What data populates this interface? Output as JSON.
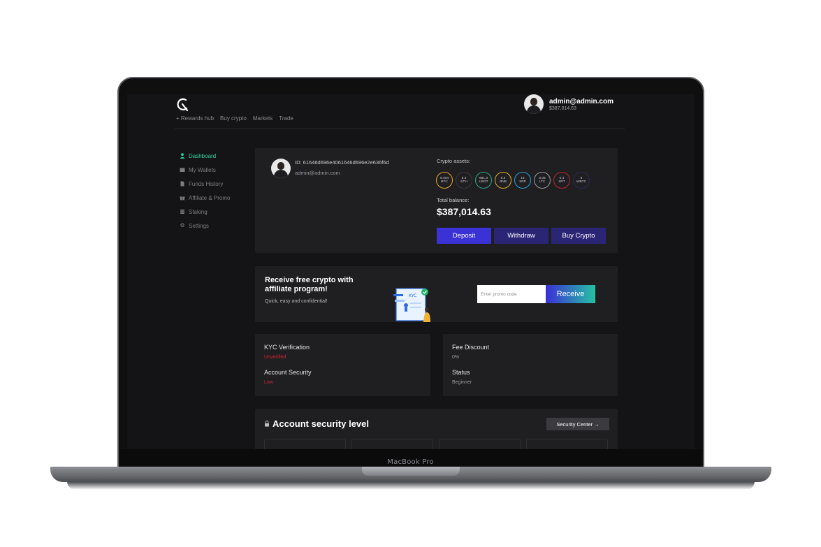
{
  "device": {
    "brand_label": "MacBook Pro"
  },
  "app": {
    "nav": [
      "+ Rewards hub",
      "Buy crypto",
      "Markets",
      "Trade"
    ],
    "user": {
      "email": "admin@admin.com",
      "balance": "$387,014.63"
    }
  },
  "sidebar": {
    "items": [
      {
        "label": "Dashboard",
        "icon": "user-icon",
        "active": true
      },
      {
        "label": "My Wallets",
        "icon": "wallet-icon",
        "active": false
      },
      {
        "label": "Funds History",
        "icon": "document-icon",
        "active": false
      },
      {
        "label": "Affiliate & Promo",
        "icon": "gift-icon",
        "active": false
      },
      {
        "label": "Staking",
        "icon": "coins-icon",
        "active": false
      },
      {
        "label": "Settings",
        "icon": "gear-icon",
        "active": false
      }
    ]
  },
  "profile": {
    "id_label": "ID: 61646d696e4061646d696e2e636f6d",
    "email": "admin@admin.com",
    "assets_label": "Crypto assets:",
    "coins": [
      {
        "amount": "6.404",
        "symbol": "BTC",
        "color": "#e6a52b"
      },
      {
        "amount": "8.4",
        "symbol": "ETH",
        "color": "#3a3a3f"
      },
      {
        "amount": "681.3",
        "symbol": "USDT",
        "color": "#2aa88a"
      },
      {
        "amount": "0.3",
        "symbol": "BNB",
        "color": "#e3b12b"
      },
      {
        "amount": "14",
        "symbol": "XRP",
        "color": "#2b9fd9"
      },
      {
        "amount": "0.05",
        "symbol": "LTC",
        "color": "#9a9aa0"
      },
      {
        "amount": "0.4",
        "symbol": "XRT",
        "color": "#c0242a"
      },
      {
        "amount": "6",
        "symbol": "WBTC",
        "color": "#2a2a5a"
      }
    ],
    "total_label": "Total balance:",
    "total_value": "$387,014.63",
    "buttons": {
      "deposit": "Deposit",
      "withdraw": "Withdraw",
      "buy": "Buy Crypto"
    }
  },
  "promo": {
    "title": "Receive free crypto with affiliate program!",
    "subtitle": "Quick, easy and confidential!",
    "input_placeholder": "Enter promo code",
    "button": "Receive",
    "illustration_text": "KYC"
  },
  "status": {
    "kyc_label": "KYC Verification",
    "kyc_value": "Unverified",
    "security_label": "Account Security",
    "security_value": "Low",
    "fee_label": "Fee Discount",
    "fee_value": "0%",
    "status_label": "Status",
    "status_value": "Beginner"
  },
  "security": {
    "title": "Account security level",
    "button": "Security Center →"
  },
  "colors": {
    "accent_green": "#2fd4a0",
    "primary_purple": "#3b32d6",
    "dark_purple": "#2b2575",
    "danger_red": "#d7262d"
  }
}
